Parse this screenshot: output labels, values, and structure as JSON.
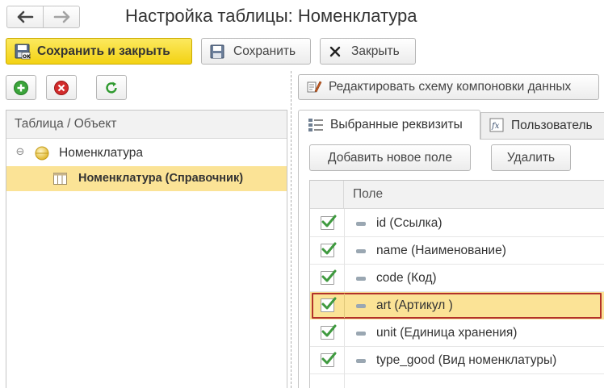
{
  "window": {
    "title": "Настройка таблицы: Номенклатура"
  },
  "command_bar": {
    "save_close_label": "Сохранить и закрыть",
    "save_label": "Сохранить",
    "close_label": "Закрыть"
  },
  "left_panel": {
    "column_header": "Таблица / Объект",
    "tree": [
      {
        "label": "Номенклатура"
      },
      {
        "label": "Номенклатура (Справочник)"
      }
    ]
  },
  "right_panel": {
    "edit_schema_label": "Редактировать схему компоновки данных",
    "tabs": [
      {
        "label": "Выбранные реквизиты"
      },
      {
        "label": "Пользователь"
      }
    ],
    "add_field_label": "Добавить новое поле",
    "delete_label": "Удалить",
    "grid_header": "Поле",
    "fields": [
      {
        "label": "id (Ссылка)",
        "checked": true
      },
      {
        "label": "name (Наименование)",
        "checked": true
      },
      {
        "label": "code (Код)",
        "checked": true
      },
      {
        "label": "art (Артикул )",
        "checked": true
      },
      {
        "label": "unit (Единица хранения)",
        "checked": true
      },
      {
        "label": "type_good (Вид номенклатуры)",
        "checked": true
      }
    ]
  },
  "colors": {
    "primary_button": "#f3d213",
    "selection_bg": "#fbe396",
    "focus_border": "#b3322a",
    "check_green": "#3f9a3f",
    "add_icon": "#3aa43a",
    "remove_icon": "#d22b2b"
  }
}
